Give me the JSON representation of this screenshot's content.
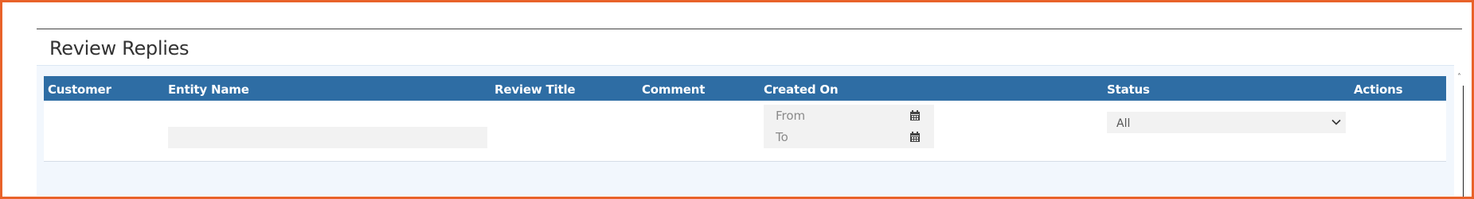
{
  "page": {
    "title": "Review Replies"
  },
  "table": {
    "columns": [
      {
        "key": "customer",
        "label": "Customer"
      },
      {
        "key": "entity_name",
        "label": "Entity Name"
      },
      {
        "key": "review_title",
        "label": "Review Title"
      },
      {
        "key": "comment",
        "label": "Comment"
      },
      {
        "key": "created_on",
        "label": "Created On"
      },
      {
        "key": "status",
        "label": "Status"
      },
      {
        "key": "actions",
        "label": "Actions"
      }
    ],
    "filters": {
      "entity_name": {
        "value": "",
        "placeholder": ""
      },
      "created_from": {
        "value": "",
        "placeholder": "From",
        "icon": "calendar-icon"
      },
      "created_to": {
        "value": "",
        "placeholder": "To",
        "icon": "calendar-icon"
      },
      "status": {
        "selected": "All",
        "icon": "chevron-down-icon"
      }
    }
  },
  "colors": {
    "header_bg": "#2e6da4",
    "header_text": "#ffffff",
    "panel_bg": "#f2f7fd",
    "input_bg": "#f2f2f2",
    "frame_border": "#e8622a"
  }
}
